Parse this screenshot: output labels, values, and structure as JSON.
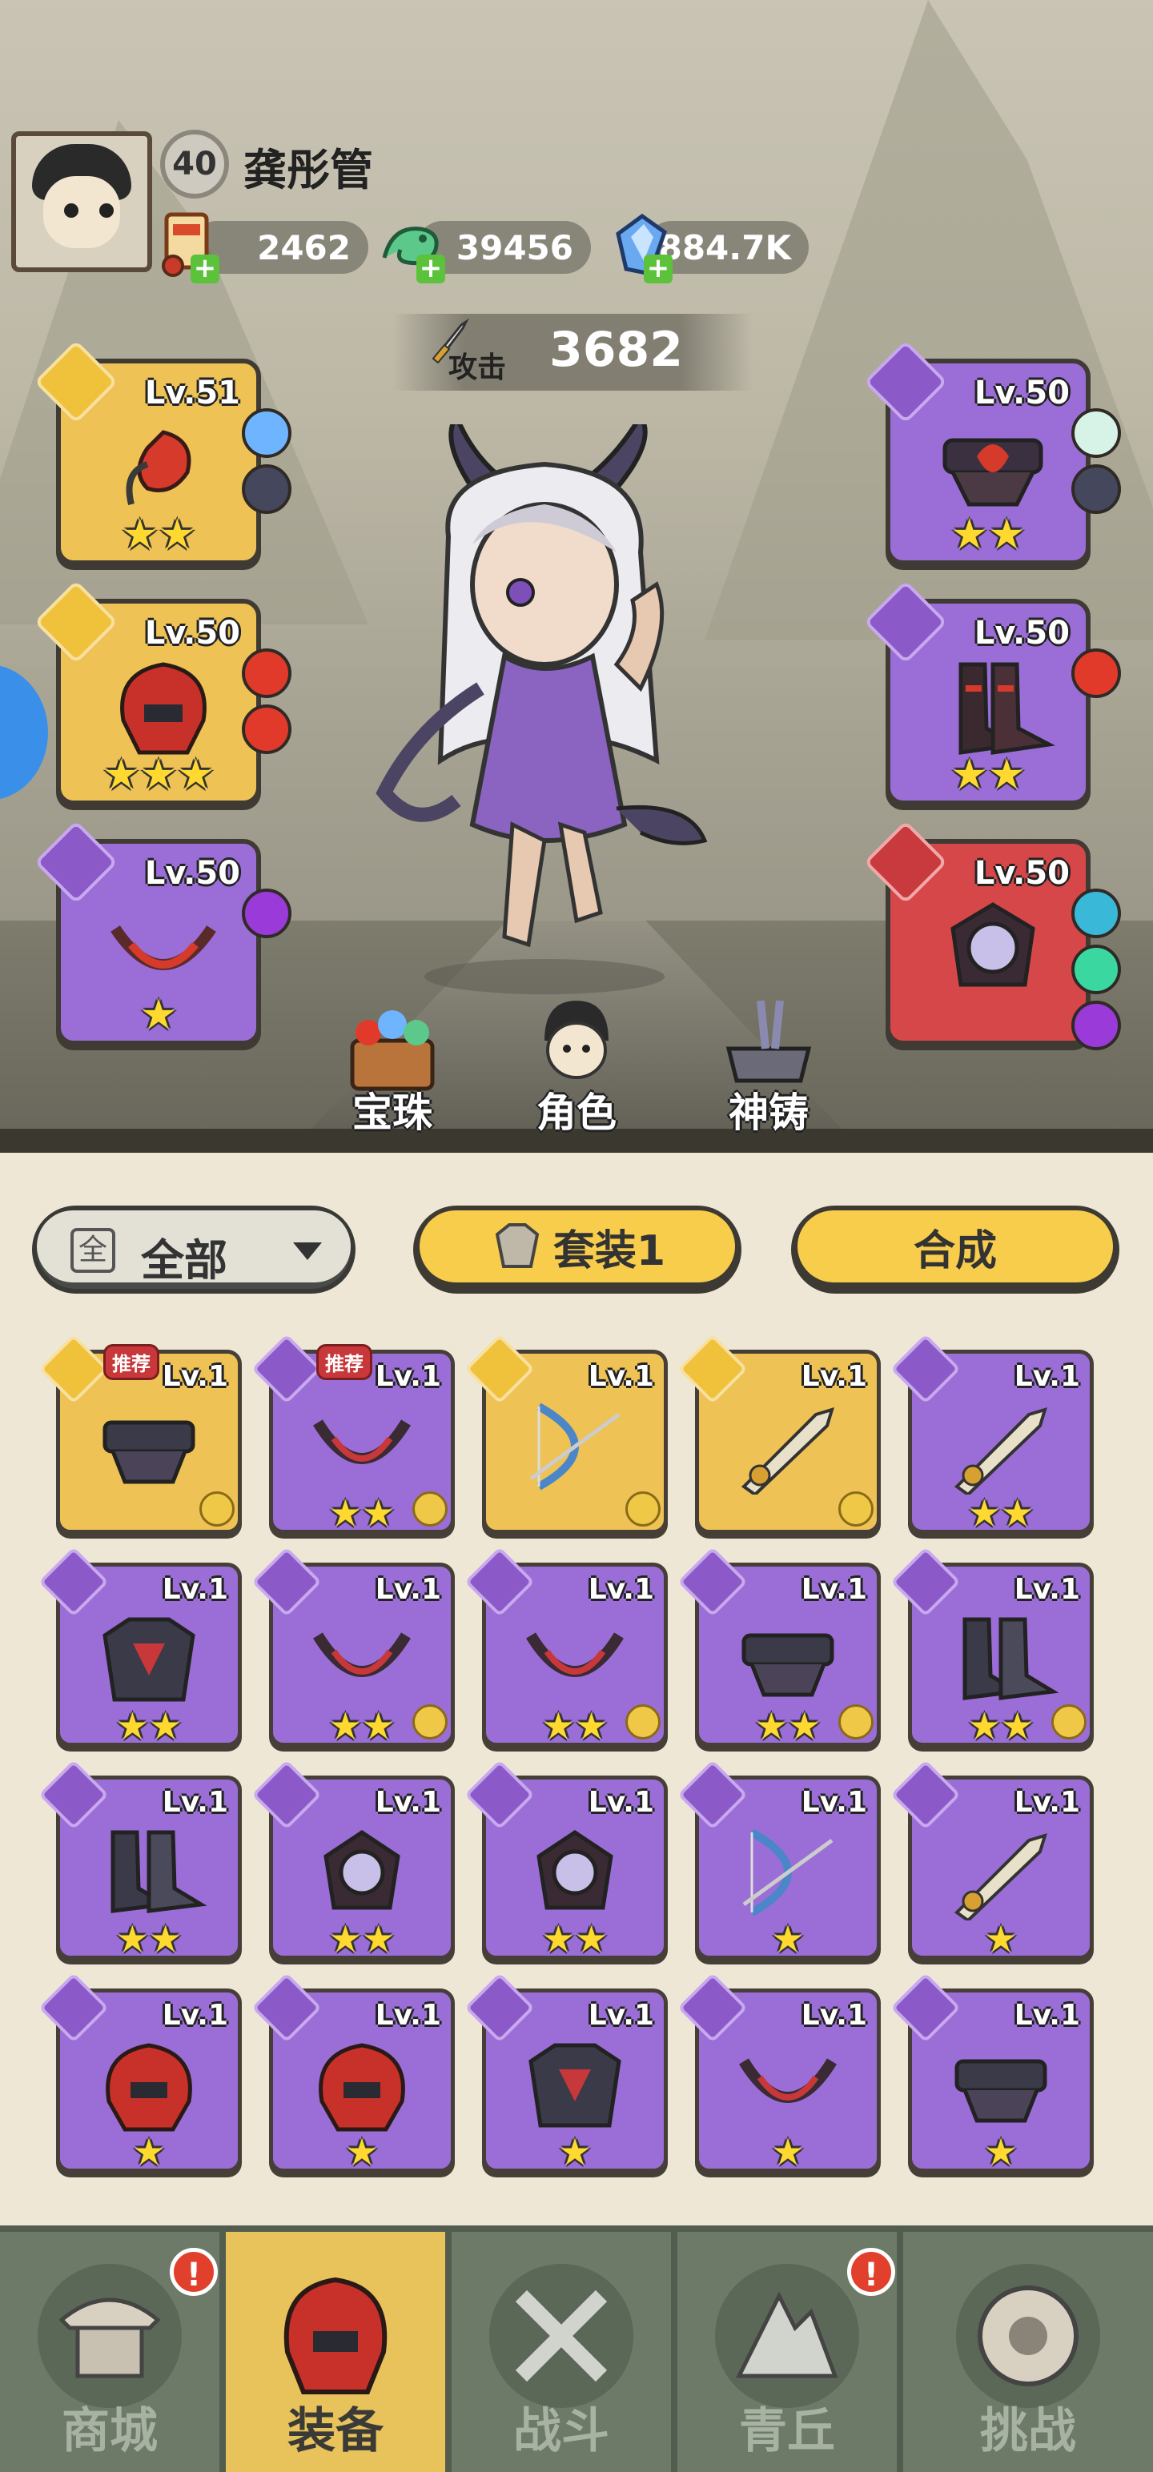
{
  "player": {
    "level": "40",
    "name": "龚彤管",
    "currencies": [
      {
        "icon": "scroll-ticket-icon",
        "value": "2462"
      },
      {
        "icon": "jade-dragon-icon",
        "value": "39456"
      },
      {
        "icon": "blue-crystal-icon",
        "value": "884.7K"
      }
    ],
    "power_label": "攻击",
    "power_value": "3682"
  },
  "equipped": [
    {
      "side": "left",
      "level": "Lv.51",
      "rarity": "gold",
      "stars": "★★",
      "slot": "weapon",
      "gems": [
        "#6fb4ff",
        "#45485c"
      ]
    },
    {
      "side": "left",
      "level": "Lv.50",
      "rarity": "gold",
      "stars": "★★★",
      "slot": "helmet",
      "gems": [
        "#e23a2a",
        "#e23a2a"
      ]
    },
    {
      "side": "left",
      "level": "Lv.50",
      "rarity": "purple",
      "stars": "★",
      "slot": "necklace",
      "gems": [
        "#9a3ad8"
      ]
    },
    {
      "side": "right",
      "level": "Lv.50",
      "rarity": "purple",
      "stars": "★★",
      "slot": "belt",
      "gems": [
        "#d7f2e6",
        "#45485c"
      ]
    },
    {
      "side": "right",
      "level": "Lv.50",
      "rarity": "purple",
      "stars": "★★",
      "slot": "boots",
      "gems": [
        "#e23a2a"
      ]
    },
    {
      "side": "right",
      "level": "Lv.50",
      "rarity": "red",
      "stars": "",
      "slot": "amulet",
      "gems": [
        "#3ab8d8",
        "#3ad8a0",
        "#9a3ad8"
      ]
    }
  ],
  "tools": [
    {
      "label": "宝珠",
      "icon": "gem-chest-icon"
    },
    {
      "label": "角色",
      "icon": "character-icon"
    },
    {
      "label": "神铸",
      "icon": "forge-anvil-icon"
    }
  ],
  "bag": {
    "filter_label": "全部",
    "filter_box": "全",
    "set_label": "套装1",
    "merge_label": "合成",
    "recommend_label": "推荐",
    "items": [
      {
        "level": "Lv.1",
        "rarity": "gold",
        "stars": "",
        "slot": "belt",
        "recommend": true,
        "set": true
      },
      {
        "level": "Lv.1",
        "rarity": "purple",
        "stars": "★★",
        "slot": "necklace",
        "recommend": true,
        "set": true
      },
      {
        "level": "Lv.1",
        "rarity": "gold",
        "stars": "",
        "slot": "bow",
        "recommend": false,
        "set": true
      },
      {
        "level": "Lv.1",
        "rarity": "gold",
        "stars": "",
        "slot": "weapon",
        "recommend": false,
        "set": true
      },
      {
        "level": "Lv.1",
        "rarity": "purple",
        "stars": "★★",
        "slot": "weapon",
        "recommend": false,
        "set": false
      },
      {
        "level": "Lv.1",
        "rarity": "purple",
        "stars": "★★",
        "slot": "armor",
        "recommend": false,
        "set": false
      },
      {
        "level": "Lv.1",
        "rarity": "purple",
        "stars": "★★",
        "slot": "necklace",
        "recommend": false,
        "set": true
      },
      {
        "level": "Lv.1",
        "rarity": "purple",
        "stars": "★★",
        "slot": "necklace",
        "recommend": false,
        "set": true
      },
      {
        "level": "Lv.1",
        "rarity": "purple",
        "stars": "★★",
        "slot": "belt",
        "recommend": false,
        "set": true
      },
      {
        "level": "Lv.1",
        "rarity": "purple",
        "stars": "★★",
        "slot": "boots",
        "recommend": false,
        "set": true
      },
      {
        "level": "Lv.1",
        "rarity": "purple",
        "stars": "★★",
        "slot": "boots",
        "recommend": false,
        "set": false
      },
      {
        "level": "Lv.1",
        "rarity": "purple",
        "stars": "★★",
        "slot": "amulet",
        "recommend": false,
        "set": false
      },
      {
        "level": "Lv.1",
        "rarity": "purple",
        "stars": "★★",
        "slot": "amulet",
        "recommend": false,
        "set": false
      },
      {
        "level": "Lv.1",
        "rarity": "purple",
        "stars": "★",
        "slot": "bow",
        "recommend": false,
        "set": false
      },
      {
        "level": "Lv.1",
        "rarity": "purple",
        "stars": "★",
        "slot": "weapon",
        "recommend": false,
        "set": false
      },
      {
        "level": "Lv.1",
        "rarity": "purple",
        "stars": "★",
        "slot": "helmet",
        "recommend": false,
        "set": false
      },
      {
        "level": "Lv.1",
        "rarity": "purple",
        "stars": "★",
        "slot": "helmet",
        "recommend": false,
        "set": false
      },
      {
        "level": "Lv.1",
        "rarity": "purple",
        "stars": "★",
        "slot": "armor",
        "recommend": false,
        "set": false
      },
      {
        "level": "Lv.1",
        "rarity": "purple",
        "stars": "★",
        "slot": "necklace",
        "recommend": false,
        "set": false
      },
      {
        "level": "Lv.1",
        "rarity": "purple",
        "stars": "★",
        "slot": "belt",
        "recommend": false,
        "set": false
      }
    ]
  },
  "nav": [
    {
      "label": "商城",
      "icon": "shop-pavilion-icon",
      "alert": "!"
    },
    {
      "label": "装备",
      "icon": "helmet-icon",
      "alert": "",
      "active": true
    },
    {
      "label": "战斗",
      "icon": "crossed-swords-icon",
      "alert": ""
    },
    {
      "label": "青丘",
      "icon": "mountain-icon",
      "alert": "!"
    },
    {
      "label": "挑战",
      "icon": "challenge-orb-icon",
      "alert": ""
    }
  ],
  "colors": {
    "gold": "#eec254",
    "purple": "#9a6ed6",
    "red": "#d6474a",
    "nav_active": "#e8c25a"
  }
}
